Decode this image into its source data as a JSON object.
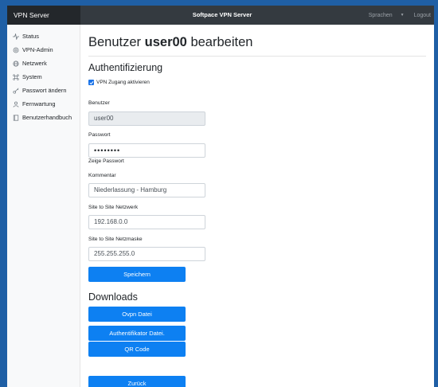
{
  "topbar": {
    "brand": "VPN Server",
    "title": "Softpace VPN Server",
    "languages": "Sprachen",
    "logout": "Logout"
  },
  "sidebar": {
    "items": [
      {
        "label": "Status",
        "icon": "activity-icon"
      },
      {
        "label": "VPN-Admin",
        "icon": "settings-icon"
      },
      {
        "label": "Netzwerk",
        "icon": "globe-icon"
      },
      {
        "label": "System",
        "icon": "command-icon"
      },
      {
        "label": "Passwort ändern",
        "icon": "key-icon"
      },
      {
        "label": "Fernwartung",
        "icon": "user-icon"
      },
      {
        "label": "Benutzerhandbuch",
        "icon": "book-icon"
      }
    ]
  },
  "main": {
    "title_prefix": "Benutzer",
    "title_user": "user00",
    "title_suffix": "bearbeiten",
    "auth_heading": "Authentifizierung",
    "vpn_checkbox_label": "VPN Zugang aktivieren",
    "vpn_checked": true,
    "user_label": "Benutzer",
    "user_value": "user00",
    "password_label": "Passwort",
    "password_value": "••••••••",
    "show_password_label": "Zeige Passwort",
    "comment_label": "Kommentar",
    "comment_value": "Niederlassung - Hamburg",
    "s2s_net_label": "Site to Site Netzwerk",
    "s2s_net_value": "192.168.0.0",
    "s2s_mask_label": "Site to Site Netzmaske",
    "s2s_mask_value": "255.255.255.0",
    "save_button": "Speichern",
    "downloads_heading": "Downloads",
    "ovpn_button": "Ovpn Datei",
    "auth_file_button": "Authentifikator Datei.",
    "qr_button": "QR Code",
    "back_button": "Zurück"
  },
  "colors": {
    "accent": "#0d80f2",
    "topbar": "#343a40",
    "background": "#1f5fa5"
  }
}
